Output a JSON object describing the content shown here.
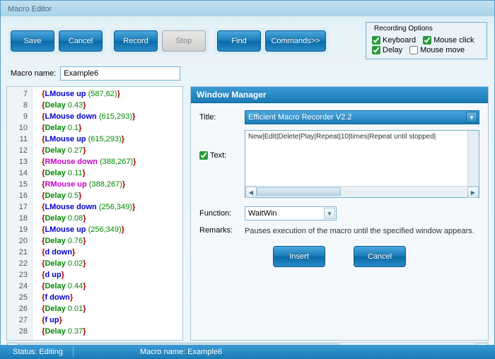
{
  "window": {
    "title": "Macro Editor"
  },
  "toolbar": {
    "save": "Save",
    "cancel": "Cancel",
    "record": "Record",
    "stop": "Stop",
    "find": "Find",
    "commands": "Commands>>"
  },
  "recording_options": {
    "legend": "Recording Options",
    "keyboard": {
      "label": "Keyboard",
      "checked": true
    },
    "mouse_click": {
      "label": "Mouse click",
      "checked": true
    },
    "delay": {
      "label": "Delay",
      "checked": true
    },
    "mouse_move": {
      "label": "Mouse move",
      "checked": false
    }
  },
  "macro_name": {
    "label": "Macro name:",
    "value": "Example6"
  },
  "code_lines": [
    {
      "n": 7,
      "type": "mouse",
      "cmd": "LMouse up",
      "args": "(587,62)"
    },
    {
      "n": 8,
      "type": "delay",
      "cmd": "Delay",
      "args": "0.43"
    },
    {
      "n": 9,
      "type": "mouse",
      "cmd": "LMouse down",
      "args": "(615,293)"
    },
    {
      "n": 10,
      "type": "delay",
      "cmd": "Delay",
      "args": "0.1"
    },
    {
      "n": 11,
      "type": "mouse",
      "cmd": "LMouse up",
      "args": "(615,293)"
    },
    {
      "n": 12,
      "type": "delay",
      "cmd": "Delay",
      "args": "0.27"
    },
    {
      "n": 13,
      "type": "rmouse",
      "cmd": "RMouse down",
      "args": "(388,267)"
    },
    {
      "n": 14,
      "type": "delay",
      "cmd": "Delay",
      "args": "0.11"
    },
    {
      "n": 15,
      "type": "rmouse",
      "cmd": "RMouse up",
      "args": "(388,267)"
    },
    {
      "n": 16,
      "type": "delay",
      "cmd": "Delay",
      "args": "0.5"
    },
    {
      "n": 17,
      "type": "mouse",
      "cmd": "LMouse down",
      "args": "(256,349)"
    },
    {
      "n": 18,
      "type": "delay",
      "cmd": "Delay",
      "args": "0.08"
    },
    {
      "n": 19,
      "type": "mouse",
      "cmd": "LMouse up",
      "args": "(256,349)"
    },
    {
      "n": 20,
      "type": "delay",
      "cmd": "Delay",
      "args": "0.76"
    },
    {
      "n": 21,
      "type": "key",
      "cmd": "d down",
      "args": ""
    },
    {
      "n": 22,
      "type": "delay",
      "cmd": "Delay",
      "args": "0.02"
    },
    {
      "n": 23,
      "type": "key",
      "cmd": "d up",
      "args": ""
    },
    {
      "n": 24,
      "type": "delay",
      "cmd": "Delay",
      "args": "0.44"
    },
    {
      "n": 25,
      "type": "key",
      "cmd": "f down",
      "args": ""
    },
    {
      "n": 26,
      "type": "delay",
      "cmd": "Delay",
      "args": "0.01"
    },
    {
      "n": 27,
      "type": "key",
      "cmd": "f up",
      "args": ""
    },
    {
      "n": 28,
      "type": "delay",
      "cmd": "Delay",
      "args": "0.37"
    }
  ],
  "panel": {
    "title": "Window Manager",
    "title_label": "Title:",
    "title_value": "Efficient Macro Recorder V2.2",
    "text_label": "Text:",
    "text_checked": true,
    "text_value": "New|Edit|Delete|Play|Repeat|10|times|Repeat until stopped|",
    "function_label": "Function:",
    "function_value": "WaitWin",
    "remarks_label": "Remarks:",
    "remarks_value": "Pauses execution of the macro until the specified window appears.",
    "insert": "Insert",
    "cancel": "Cancel"
  },
  "statusbar": {
    "status": "Status: Editing",
    "macro": "Macro name: Example6"
  }
}
